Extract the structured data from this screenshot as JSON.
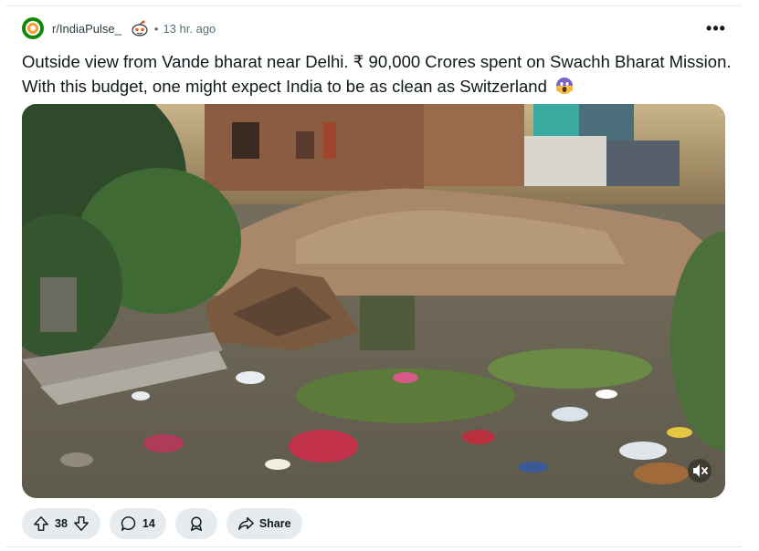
{
  "post": {
    "subreddit": "r/IndiaPulse_",
    "separator": "•",
    "time": "13 hr. ago",
    "more_label": "•••",
    "title": "Outside view from Vande bharat near Delhi. ₹ 90,000 Crores spent on Swachh Bharat Mission. With this budget, one might expect India to be as clean as Switzerland",
    "title_emoji": "screaming-face-emoji"
  },
  "actions": {
    "upvotes": "38",
    "comments": "14",
    "share_label": "Share"
  },
  "icons": {
    "upvote": "upvote-arrow-icon",
    "downvote": "downvote-arrow-icon",
    "comment": "comment-bubble-icon",
    "award": "award-icon",
    "share": "share-arrow-icon",
    "mute": "muted-speaker-icon"
  },
  "colors": {
    "pill_bg": "#e5ebee",
    "text": "#0f1a1c",
    "meta": "#576f76"
  }
}
